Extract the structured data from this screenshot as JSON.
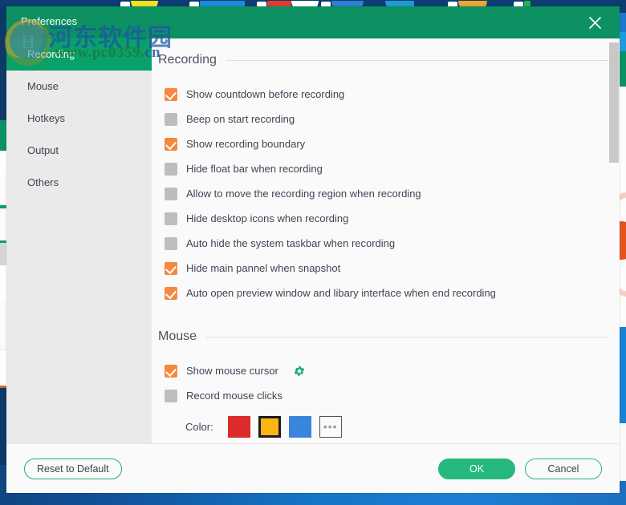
{
  "window": {
    "title": "Preferences",
    "close_icon": "close-icon",
    "titlebar_color": "#0d9162"
  },
  "watermark": {
    "logo_letter": "H",
    "cn_text": "河东软件园",
    "url_green": "www.pc0359.",
    "url_blue": "cn"
  },
  "sidebar": {
    "items": [
      {
        "label": "Recording",
        "active": true
      },
      {
        "label": "Mouse",
        "active": false
      },
      {
        "label": "Hotkeys",
        "active": false
      },
      {
        "label": "Output",
        "active": false
      },
      {
        "label": "Others",
        "active": false
      }
    ],
    "active_color": "#0aa06a",
    "background": "#eaeaea"
  },
  "content": {
    "sections": [
      {
        "title": "Recording",
        "options": [
          {
            "label": "Show countdown before recording",
            "checked": true
          },
          {
            "label": "Beep on start recording",
            "checked": false
          },
          {
            "label": "Show recording boundary",
            "checked": true
          },
          {
            "label": "Hide float bar when recording",
            "checked": false
          },
          {
            "label": "Allow to move the recording region when recording",
            "checked": false
          },
          {
            "label": "Hide desktop icons when recording",
            "checked": false
          },
          {
            "label": "Auto hide the system taskbar when recording",
            "checked": false
          },
          {
            "label": "Hide main pannel when snapshot",
            "checked": true
          },
          {
            "label": "Auto open preview window and libary interface when end recording",
            "checked": true
          }
        ]
      },
      {
        "title": "Mouse",
        "options": [
          {
            "label": "Show mouse cursor",
            "checked": true,
            "gear": "gear-icon"
          },
          {
            "label": "Record mouse clicks",
            "checked": false
          }
        ],
        "color_row": {
          "label": "Color:",
          "swatches": [
            {
              "name": "red",
              "hex": "#dc2b2b",
              "selected": false
            },
            {
              "name": "amber",
              "hex": "#fcb415",
              "selected": true
            },
            {
              "name": "blue",
              "hex": "#3b85de",
              "selected": false
            }
          ],
          "more_label": "•••"
        }
      }
    ],
    "checked_color": "#f5883f",
    "unchecked_color": "#bdbdbd"
  },
  "footer": {
    "reset_label": "Reset to Default",
    "ok_label": "OK",
    "cancel_label": "Cancel",
    "accent": "#25b97d"
  }
}
